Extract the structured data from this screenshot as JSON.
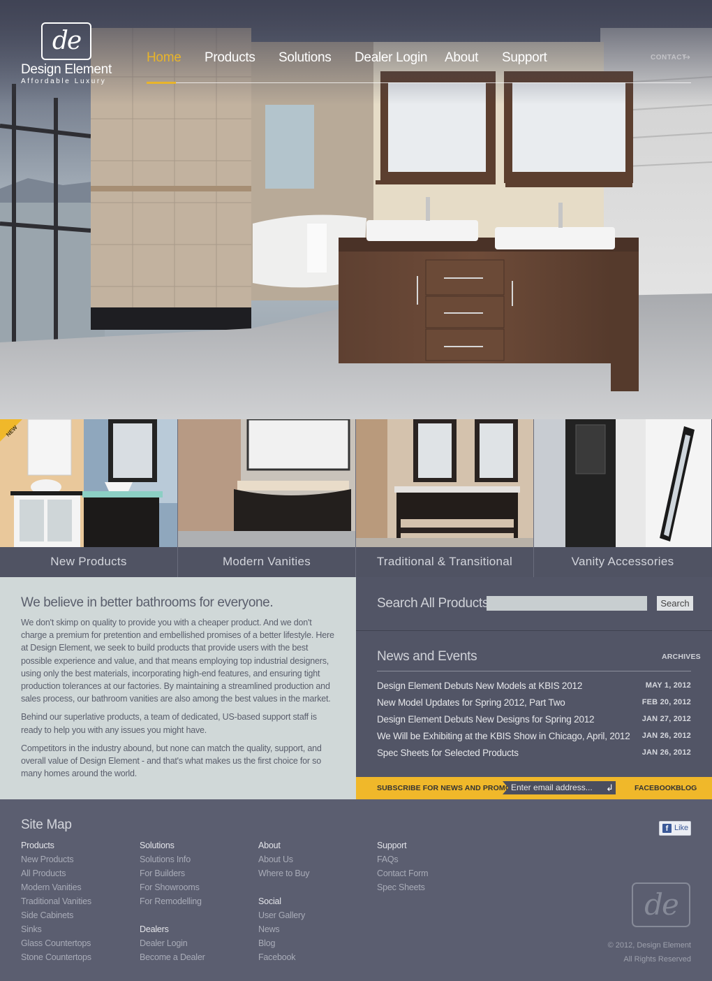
{
  "brand": {
    "logo_mark": "de",
    "name": "Design Element",
    "tagline": "Affordable Luxury"
  },
  "nav": {
    "items": [
      {
        "label": "Home",
        "active": true
      },
      {
        "label": "Products",
        "active": false
      },
      {
        "label": "Solutions",
        "active": false
      },
      {
        "label": "Dealer Login",
        "active": false
      },
      {
        "label": "About",
        "active": false
      },
      {
        "label": "Support",
        "active": false
      }
    ],
    "contact": "CONTACT",
    "contact_icon": "arrow-icon"
  },
  "categories": [
    {
      "label": "New Products",
      "badge": "NEW"
    },
    {
      "label": "Modern Vanities"
    },
    {
      "label": "Traditional & Transitional"
    },
    {
      "label": "Vanity Accessories"
    }
  ],
  "about": {
    "heading": "We believe in better bathrooms for everyone.",
    "paragraphs": [
      "We don't skimp on quality to provide you with a cheaper product. And we don't charge a premium for pretention and embellished promises of a better lifestyle. Here at Design Element, we seek to build products that provide users with the best possible experience and value, and that means employing top industrial designers, using only the best materials, incorporating high-end features, and ensuring tight production tolerances at our factories. By maintaining a streamlined production and sales process, our bathroom vanities are also among the best values in the market.",
      "Behind our superlative products, a team of dedicated, US-based support staff is ready to help you with any issues you might have.",
      "Competitors in the industry abound, but none can match the quality, support, and overall value of Design Element - and that's what makes us the first choice for so many homes around the world."
    ]
  },
  "search": {
    "title": "Search All Products",
    "input_value": "",
    "button": "Search"
  },
  "news": {
    "title": "News and Events",
    "archives": "ARCHIVES",
    "items": [
      {
        "text": "Design Element Debuts New Models at KBIS 2012",
        "date": "MAY 1, 2012"
      },
      {
        "text": "New Model Updates for Spring 2012, Part Two",
        "date": "FEB 20, 2012"
      },
      {
        "text": "Design Element Debuts New Designs for Spring 2012",
        "date": "JAN 27, 2012"
      },
      {
        "text": "We Will be Exhibiting at the KBIS Show in Chicago, April, 2012",
        "date": "JAN 26, 2012"
      },
      {
        "text": "Spec Sheets for Selected Products",
        "date": "JAN 26, 2012"
      }
    ]
  },
  "subscribe": {
    "label": "SUBSCRIBE FOR NEWS AND PROMOTIONS",
    "placeholder": "Enter email address...",
    "enter_icon": "enter-icon",
    "facebook": "FACEBOOK",
    "blog": "BLOG"
  },
  "footer": {
    "title": "Site Map",
    "like": "Like",
    "columns": [
      {
        "groups": [
          {
            "head": "Products",
            "links": [
              "New Products",
              "All Products",
              "Modern Vanities",
              "Traditional Vanities",
              "Side Cabinets",
              "Sinks",
              "Glass Countertops",
              "Stone Countertops"
            ]
          }
        ]
      },
      {
        "groups": [
          {
            "head": "Solutions",
            "links": [
              "Solutions Info",
              "For Builders",
              "For Showrooms",
              "For Remodelling"
            ]
          },
          {
            "head": "Dealers",
            "links": [
              "Dealer Login",
              "Become a Dealer"
            ]
          }
        ]
      },
      {
        "groups": [
          {
            "head": "About",
            "links": [
              "About Us",
              "Where to Buy"
            ]
          },
          {
            "head": "Social",
            "links": [
              "User Gallery",
              "News",
              "Blog",
              "Facebook"
            ]
          }
        ]
      },
      {
        "groups": [
          {
            "head": "Support",
            "links": [
              "FAQs",
              "Contact Form",
              "Spec Sheets"
            ]
          }
        ]
      }
    ],
    "copyright": "© 2012, Design Element",
    "rights": "All Rights Reserved"
  },
  "colors": {
    "accent": "#e8b42a",
    "dark_panel": "#525566",
    "footer": "#5b5e70",
    "about_bg": "#d0d8d8"
  }
}
